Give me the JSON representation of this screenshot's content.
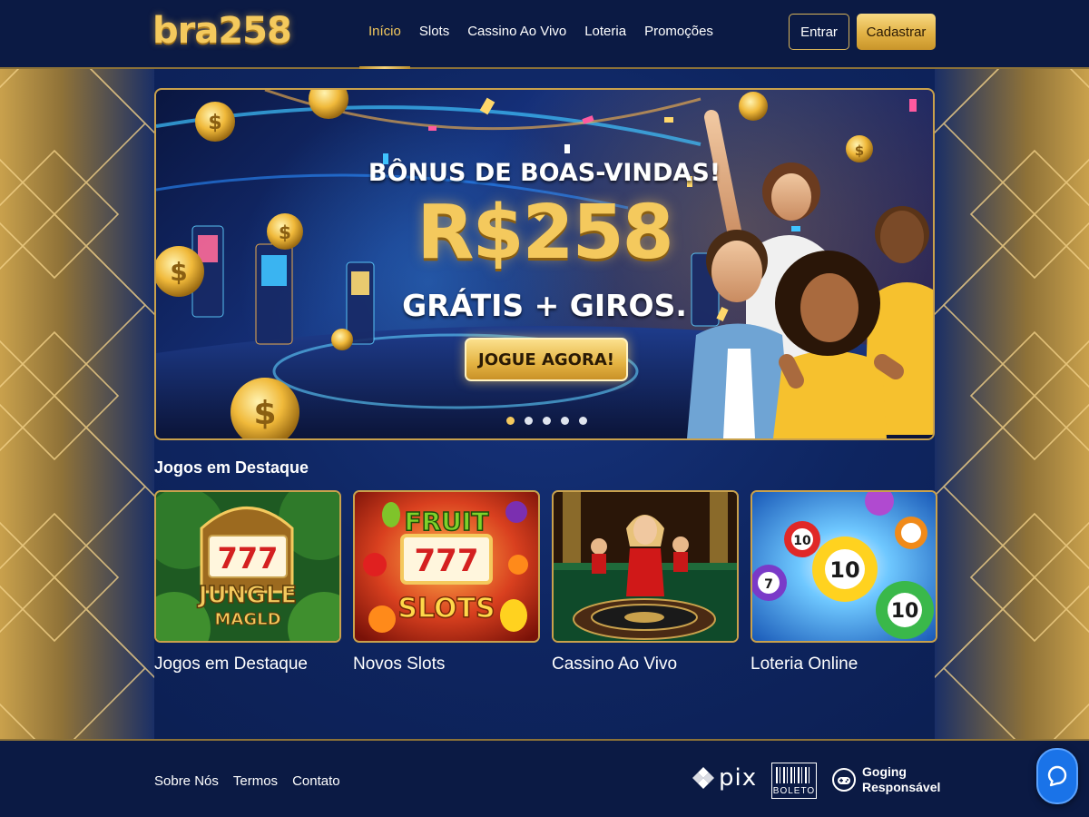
{
  "brand": {
    "logo_text": "bra258"
  },
  "nav": {
    "items": [
      {
        "label": "Início",
        "active": true
      },
      {
        "label": "Slots",
        "active": false
      },
      {
        "label": "Cassino Ao Vivo",
        "active": false
      },
      {
        "label": "Loteria",
        "active": false
      },
      {
        "label": "Promoções",
        "active": false
      }
    ]
  },
  "auth": {
    "login_label": "Entrar",
    "register_label": "Cadastrar"
  },
  "hero": {
    "subtitle": "BÔNUS DE BOAS-VINDAS!",
    "amount": "R$258",
    "extra": "GRÁTIS + GIROS.",
    "cta_label": "JOGUE AGORA!",
    "slides_total": 5,
    "active_slide": 1
  },
  "featured": {
    "title": "Jogos em Destaque",
    "cards": [
      {
        "label": "Jogos em Destaque",
        "art_line1": "JUNGLE",
        "art_line2": "MAGLD",
        "reels": "777"
      },
      {
        "label": "Novos Slots",
        "art_line1": "FRUIT",
        "art_line2": "SLOTS",
        "reels": "777"
      },
      {
        "label": "Cassino Ao Vivo"
      },
      {
        "label": "Loteria Online",
        "balls": [
          "10",
          "10",
          "7",
          "10"
        ]
      }
    ]
  },
  "footer": {
    "links": [
      "Sobre Nós",
      "Termos",
      "Contato"
    ],
    "payments": {
      "pix": "pix",
      "boleto": "BOLETO",
      "responsible_line1": "Goging",
      "responsible_line2": "Responsável"
    }
  },
  "colors": {
    "gold": "#f4c95d",
    "navy": "#0b1a44",
    "chat": "#1a73e8"
  }
}
